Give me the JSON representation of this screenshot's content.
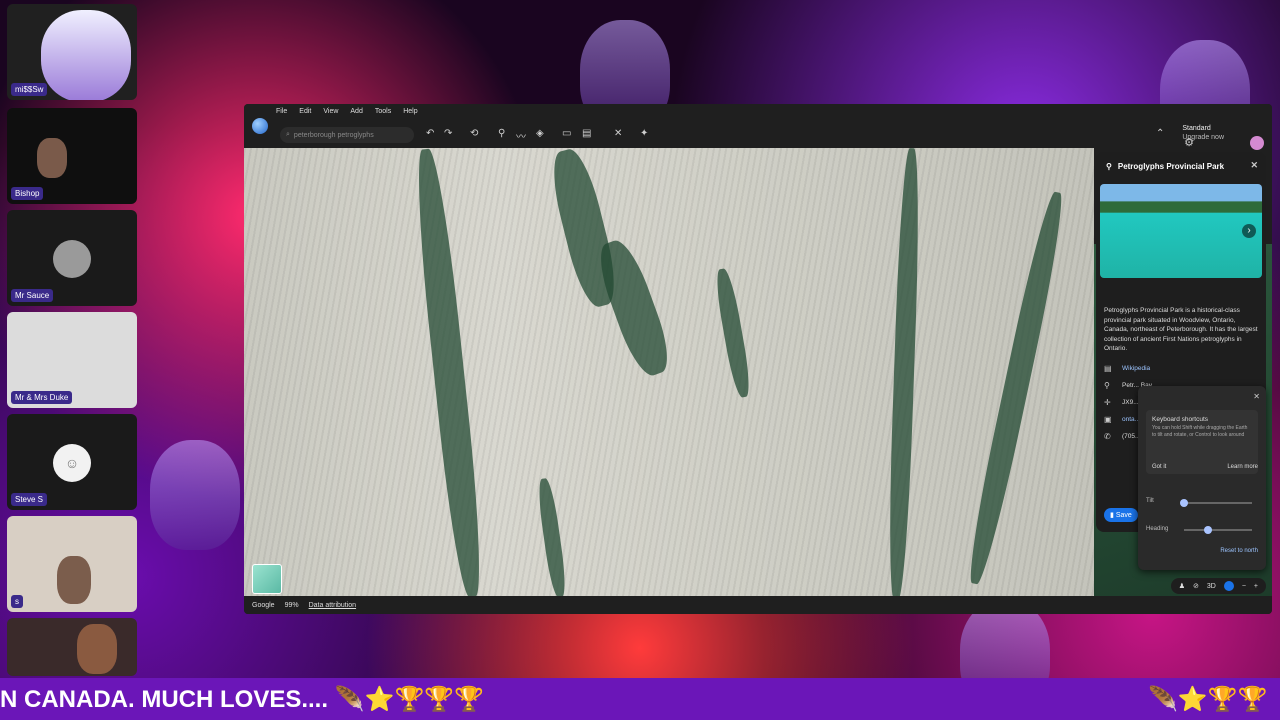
{
  "participants": [
    {
      "name": "mi$$Sw"
    },
    {
      "name": "Bishop"
    },
    {
      "name": "Mr Sauce"
    },
    {
      "name": "Mr & Mrs Duke"
    },
    {
      "name": "Steve S"
    },
    {
      "name": "s"
    },
    {
      "name": ""
    }
  ],
  "earth": {
    "menus": [
      "File",
      "Edit",
      "View",
      "Add",
      "Tools",
      "Help"
    ],
    "search_placeholder": "peterborough petroglyphs",
    "account": {
      "plan": "Standard",
      "upgrade": "Upgrade now"
    },
    "footer": {
      "brand": "Google",
      "percent": "99%",
      "attribution": "Data attribution"
    },
    "controls": {
      "mode_3d": "3D"
    }
  },
  "place": {
    "title": "Petroglyphs Provincial Park",
    "description": "Petroglyphs Provincial Park is a historical-class provincial park situated in Woodview, Ontario, Canada, northeast of Peterborough. It has the largest collection of ancient First Nations petroglyphs in Ontario.",
    "rows": [
      {
        "icon": "wiki-icon",
        "text": "Wikipedia"
      },
      {
        "icon": "location-icon",
        "text": "Petr... Bay"
      },
      {
        "icon": "plus-code-icon",
        "text": "JX9..."
      },
      {
        "icon": "website-icon",
        "text": "onta..."
      },
      {
        "icon": "phone-icon",
        "text": "(705..."
      }
    ],
    "save_label": "Save"
  },
  "shortcuts": {
    "title": "Keyboard shortcuts",
    "body": "You can hold Shift while dragging the Earth to tilt and rotate, or Control to look around",
    "got_it": "Got it",
    "learn_more": "Learn more",
    "tilt_label": "Tilt",
    "heading_label": "Heading",
    "reset": "Reset to north",
    "tilt_value": 0.0,
    "heading_value": 0.35
  },
  "ticker": {
    "text_left": "N CANADA. MUCH LOVES.... 🪶⭐🏆🏆🏆",
    "text_right": "🪶⭐🏆🏆"
  }
}
